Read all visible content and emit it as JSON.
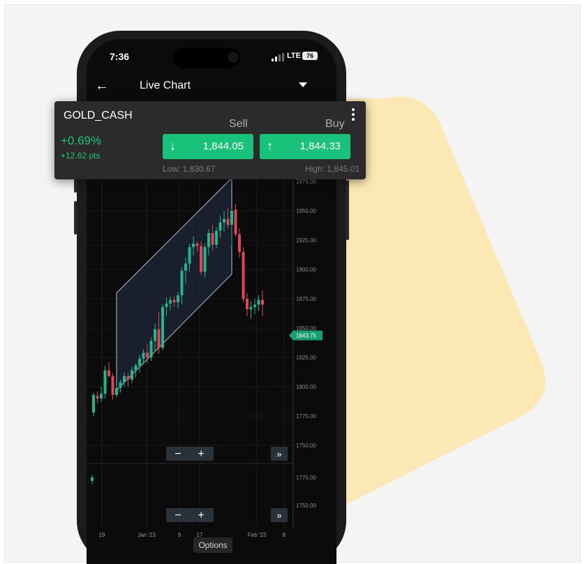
{
  "colors": {
    "accent_bg": "#fbe8b4",
    "up": "#26b58b",
    "down": "#e0465a",
    "buy_sell_button": "#19c27a",
    "chart_bg": "#0b0b0b",
    "channel_fill": "#1d2436"
  },
  "status_bar": {
    "time": "7:36",
    "network": "LTE",
    "battery": "76"
  },
  "app_bar": {
    "title": "Live Chart",
    "back_icon": "arrow-left-icon",
    "menu_icon": "caret-down-icon"
  },
  "quote_panel": {
    "symbol": "GOLD_CASH",
    "change_pct": "+0.69%",
    "change_pts": "+12.62 pts",
    "sell_label": "Sell",
    "buy_label": "Buy",
    "sell_price": "1,844.05",
    "buy_price": "1,844.33",
    "low": "Low: 1,830.67",
    "high": "High: 1,845.01",
    "sell_icon": "arrow-down-icon",
    "buy_icon": "arrow-up-icon",
    "more_icon": "more-vertical-icon"
  },
  "chart_data": {
    "type": "candlestick",
    "symbol": "GOLD_CASH",
    "x_ticks": [
      "19",
      "Jan '23",
      "9",
      "17",
      "Feb '23",
      "8"
    ],
    "y_ticks": [
      "1975.00",
      "1950.00",
      "1925.00",
      "1900.00",
      "1875.00",
      "1850.00",
      "1825.00",
      "1800.00",
      "1775.00",
      "1750.00"
    ],
    "y_ticks_lower": [
      "1775.00",
      "1750.00"
    ],
    "ylim": [
      1740,
      1985
    ],
    "current_price": "1843.75",
    "candles": [
      [
        1778,
        1795,
        1775,
        1793
      ],
      [
        1792,
        1796,
        1786,
        1790
      ],
      [
        1790,
        1800,
        1787,
        1794
      ],
      [
        1794,
        1818,
        1790,
        1814
      ],
      [
        1814,
        1821,
        1808,
        1809
      ],
      [
        1809,
        1812,
        1789,
        1793
      ],
      [
        1793,
        1801,
        1791,
        1799
      ],
      [
        1799,
        1806,
        1795,
        1804
      ],
      [
        1804,
        1812,
        1800,
        1809
      ],
      [
        1809,
        1812,
        1800,
        1806
      ],
      [
        1806,
        1817,
        1803,
        1814
      ],
      [
        1814,
        1820,
        1808,
        1818
      ],
      [
        1818,
        1827,
        1812,
        1824
      ],
      [
        1824,
        1832,
        1819,
        1829
      ],
      [
        1829,
        1836,
        1820,
        1825
      ],
      [
        1825,
        1842,
        1822,
        1839
      ],
      [
        1839,
        1854,
        1830,
        1849
      ],
      [
        1849,
        1864,
        1828,
        1833
      ],
      [
        1833,
        1870,
        1831,
        1868
      ],
      [
        1868,
        1876,
        1860,
        1871
      ],
      [
        1871,
        1877,
        1865,
        1874
      ],
      [
        1874,
        1877,
        1868,
        1872
      ],
      [
        1872,
        1881,
        1867,
        1878
      ],
      [
        1878,
        1902,
        1870,
        1899
      ],
      [
        1899,
        1910,
        1888,
        1905
      ],
      [
        1905,
        1922,
        1898,
        1919
      ],
      [
        1919,
        1928,
        1912,
        1922
      ],
      [
        1922,
        1924,
        1915,
        1920
      ],
      [
        1920,
        1924,
        1895,
        1898
      ],
      [
        1898,
        1922,
        1893,
        1919
      ],
      [
        1919,
        1934,
        1912,
        1931
      ],
      [
        1931,
        1938,
        1916,
        1921
      ],
      [
        1921,
        1936,
        1918,
        1933
      ],
      [
        1933,
        1946,
        1927,
        1940
      ],
      [
        1940,
        1950,
        1932,
        1943
      ],
      [
        1943,
        1952,
        1935,
        1938
      ],
      [
        1938,
        1952,
        1920,
        1950
      ],
      [
        1951,
        1956,
        1928,
        1930
      ],
      [
        1930,
        1935,
        1910,
        1915
      ],
      [
        1915,
        1919,
        1872,
        1875
      ],
      [
        1875,
        1880,
        1860,
        1866
      ],
      [
        1866,
        1873,
        1858,
        1868
      ],
      [
        1868,
        1875,
        1862,
        1870
      ],
      [
        1870,
        1878,
        1865,
        1874
      ],
      [
        1874,
        1882,
        1860,
        1870
      ]
    ],
    "lower_candle": [
      1772,
      1777,
      1769,
      1775
    ],
    "channel": {
      "upper_start": [
        6,
        1880
      ],
      "upper_end": [
        36,
        1978
      ],
      "lower_start": [
        6,
        1797
      ],
      "lower_end": [
        36,
        1896
      ]
    }
  },
  "controls": {
    "zoom_out": "−",
    "zoom_in": "+",
    "scroll_right": "»",
    "options": "Options"
  }
}
